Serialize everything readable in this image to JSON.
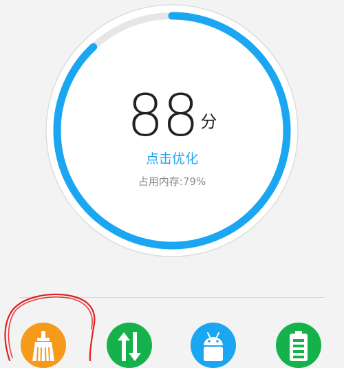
{
  "gauge": {
    "score": "88",
    "unit": "分",
    "action_label": "点击优化",
    "memory_label": "占用内存:79%",
    "progress_fraction": 0.88,
    "colors": {
      "arc": "#1aa6f0",
      "track": "#e6e6e6",
      "ring_border": "#dcdcdc",
      "face": "#ffffff"
    }
  },
  "tools": [
    {
      "name": "clean",
      "icon": "broom-icon",
      "color": "#f59a1b"
    },
    {
      "name": "traffic",
      "icon": "up-down-arrows-icon",
      "color": "#15b24b"
    },
    {
      "name": "apps",
      "icon": "android-icon",
      "color": "#1aa6f0"
    },
    {
      "name": "battery",
      "icon": "battery-icon",
      "color": "#15b24b"
    }
  ],
  "annotation_color": "#e02020"
}
